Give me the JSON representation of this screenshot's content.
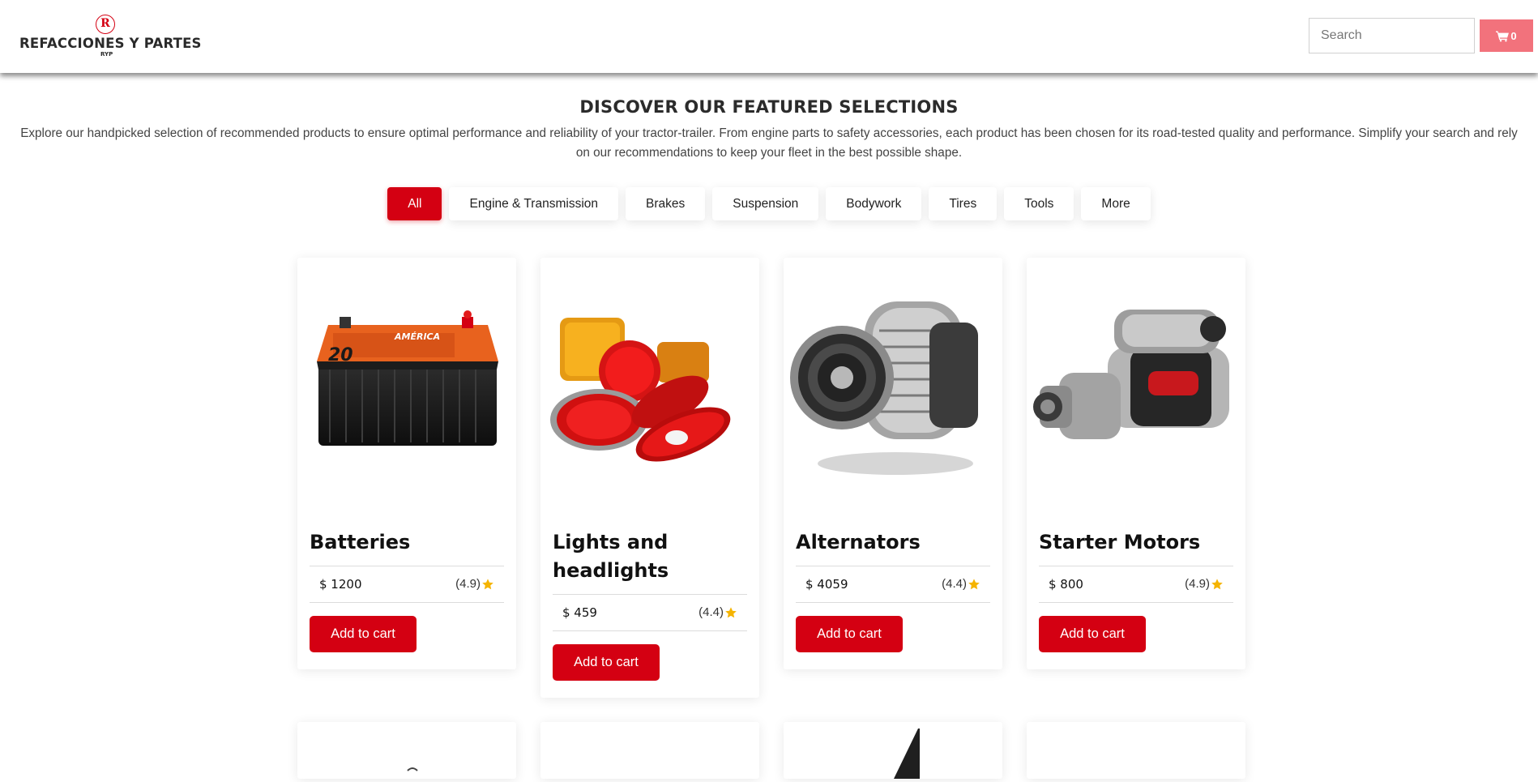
{
  "header": {
    "logo_mark": "R",
    "logo_text": "REFACCIONES Y PARTES",
    "logo_sub": "RYP",
    "search_placeholder": "Search",
    "cart_count": "0"
  },
  "intro": {
    "title": "DISCOVER OUR FEATURED SELECTIONS",
    "description": "Explore our handpicked selection of recommended products to ensure optimal performance and reliability of your tractor-trailer. From engine parts to safety accessories, each product has been chosen for its road-tested quality and performance. Simplify your search and rely on our recommendations to keep your fleet in the best possible shape."
  },
  "filters": [
    {
      "label": "All",
      "active": true
    },
    {
      "label": "Engine & Transmission",
      "active": false
    },
    {
      "label": "Brakes",
      "active": false
    },
    {
      "label": "Suspension",
      "active": false
    },
    {
      "label": "Bodywork",
      "active": false
    },
    {
      "label": "Tires",
      "active": false
    },
    {
      "label": "Tools",
      "active": false
    },
    {
      "label": "More",
      "active": false
    }
  ],
  "products": [
    {
      "name": "Batteries",
      "price": "$ 1200",
      "rating": "(4.9)",
      "button": "Add to cart",
      "image_icon": "car-battery-image"
    },
    {
      "name": "Lights and headlights",
      "price": "$ 459",
      "rating": "(4.4)",
      "button": "Add to cart",
      "image_icon": "truck-lights-image"
    },
    {
      "name": "Alternators",
      "price": "$ 4059",
      "rating": "(4.4)",
      "button": "Add to cart",
      "image_icon": "alternator-image"
    },
    {
      "name": "Starter Motors",
      "price": "$ 800",
      "rating": "(4.9)",
      "button": "Add to cart",
      "image_icon": "starter-motor-image"
    }
  ],
  "colors": {
    "accent": "#d40012",
    "cart_button": "#f2727c",
    "star": "#f5b400"
  }
}
